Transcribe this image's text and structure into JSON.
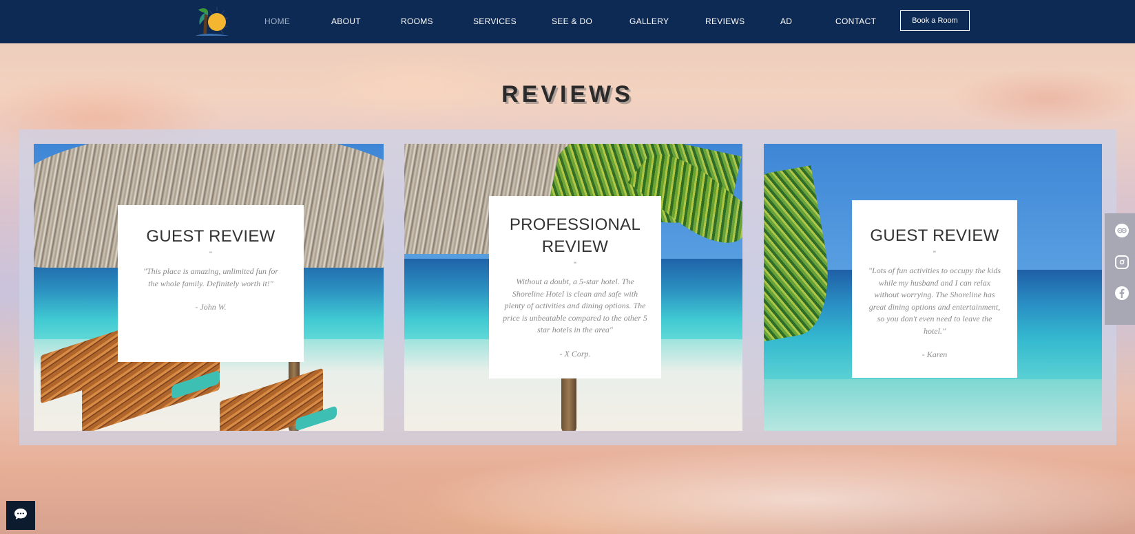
{
  "header": {
    "logo_icon": "sun-palm-logo-icon",
    "nav": [
      {
        "label": "HOME",
        "active": true
      },
      {
        "label": "ABOUT"
      },
      {
        "label": "ROOMS"
      },
      {
        "label": "SERVICES"
      },
      {
        "label": "SEE & DO"
      },
      {
        "label": "GALLERY"
      },
      {
        "label": "REVIEWS"
      },
      {
        "label": "AD"
      },
      {
        "label": "CONTACT"
      }
    ],
    "book_label": "Book a Room"
  },
  "page": {
    "title": "REVIEWS"
  },
  "reviews": [
    {
      "title": "GUEST REVIEW",
      "mark": "\"",
      "quote": "\"This place is amazing, unlimited fun for the whole family. Definitely worth it!\"",
      "author": "-  John W."
    },
    {
      "title": "PROFESSIONAL REVIEW",
      "mark": "\"",
      "quote": "Without a doubt, a 5-star hotel. The Shoreline Hotel is clean and safe with plenty of activities and dining options. The price is unbeatable compared to the other 5 star hotels in the area\"",
      "author": "-  X Corp."
    },
    {
      "title": "GUEST REVIEW",
      "mark": "\"",
      "quote": "\"Lots of fun activities to occupy the kids while my husband and I can relax without worrying. The Shoreline has great dining options and entertainment, so you don't even need to leave the hotel.\"",
      "author": "-  Karen"
    }
  ],
  "social": [
    "tripadvisor-icon",
    "instagram-icon",
    "facebook-icon"
  ],
  "chat_icon": "chat-bubble-icon",
  "colors": {
    "header_bg": "#0d2a55",
    "nav_active": "#9fb0c7",
    "title_text": "#2b2b2b",
    "quote_text": "#8c8c8c"
  }
}
